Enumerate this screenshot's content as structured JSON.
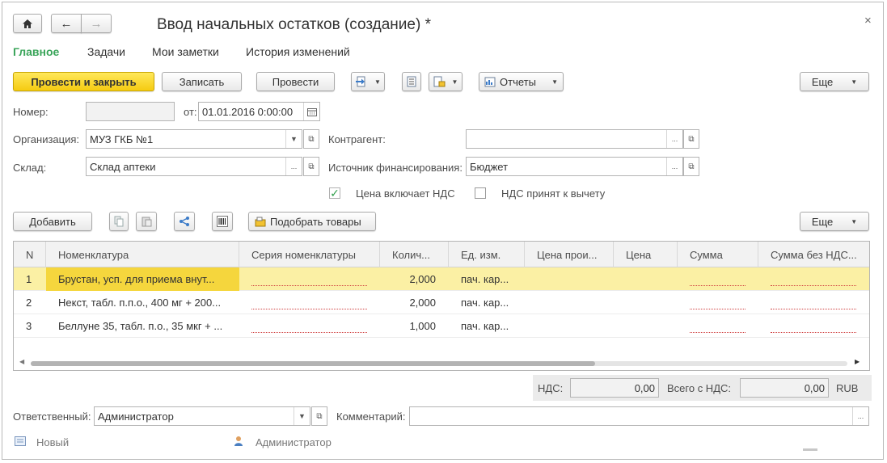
{
  "window": {
    "title": "Ввод начальных остатков (создание) *"
  },
  "tabs": [
    {
      "label": "Главное",
      "active": true
    },
    {
      "label": "Задачи"
    },
    {
      "label": "Мои заметки"
    },
    {
      "label": "История изменений"
    }
  ],
  "toolbar": {
    "post_close": "Провести и закрыть",
    "save": "Записать",
    "post": "Провести",
    "reports": "Отчеты",
    "more": "Еще"
  },
  "form": {
    "number_label": "Номер:",
    "number_value": "",
    "date_label": "от:",
    "date_value": "01.01.2016  0:00:00",
    "org_label": "Организация:",
    "org_value": "МУЗ ГКБ №1",
    "warehouse_label": "Склад:",
    "warehouse_value": "Склад аптеки",
    "counterparty_label": "Контрагент:",
    "counterparty_value": "",
    "funding_label": "Источник финансирования:",
    "funding_value": "Бюджет",
    "price_vat_label": "Цена включает НДС",
    "price_vat_checked": true,
    "vat_deduct_label": "НДС принят к вычету",
    "vat_deduct_checked": false
  },
  "table_toolbar": {
    "add": "Добавить",
    "pick": "Подобрать товары",
    "more": "Еще"
  },
  "table": {
    "columns": [
      "N",
      "Номенклатура",
      "Серия номенклатуры",
      "Колич...",
      "Ед. изм.",
      "Цена прои...",
      "Цена",
      "Сумма",
      "Сумма без НДС..."
    ],
    "rows": [
      {
        "n": "1",
        "name": "Брустан, усп. для приема внут...",
        "series": "",
        "qty": "2,000",
        "unit": "пач. кар...",
        "price_prod": "",
        "price": "",
        "sum": "",
        "sum_no_vat": ""
      },
      {
        "n": "2",
        "name": "Некст, табл. п.п.о., 400 мг + 200...",
        "series": "",
        "qty": "2,000",
        "unit": "пач. кар...",
        "price_prod": "",
        "price": "",
        "sum": "",
        "sum_no_vat": ""
      },
      {
        "n": "3",
        "name": "Беллуне 35, табл. п.о., 35 мкг + ...",
        "series": "",
        "qty": "1,000",
        "unit": "пач. кар...",
        "price_prod": "",
        "price": "",
        "sum": "",
        "sum_no_vat": ""
      }
    ],
    "selected_row": 0
  },
  "totals": {
    "vat_label": "НДС:",
    "vat_value": "0,00",
    "total_label": "Всего с НДС:",
    "total_value": "0,00",
    "currency": "RUB"
  },
  "footer": {
    "responsible_label": "Ответственный:",
    "responsible_value": "Администратор",
    "comment_label": "Комментарий:",
    "comment_value": "",
    "status": "Новый",
    "author": "Администратор"
  },
  "colors": {
    "accent_green": "#3aa55a",
    "primary_yellow": "#f5cb11",
    "row_selected": "#fbf0a4",
    "cell_current": "#f5d63d"
  }
}
